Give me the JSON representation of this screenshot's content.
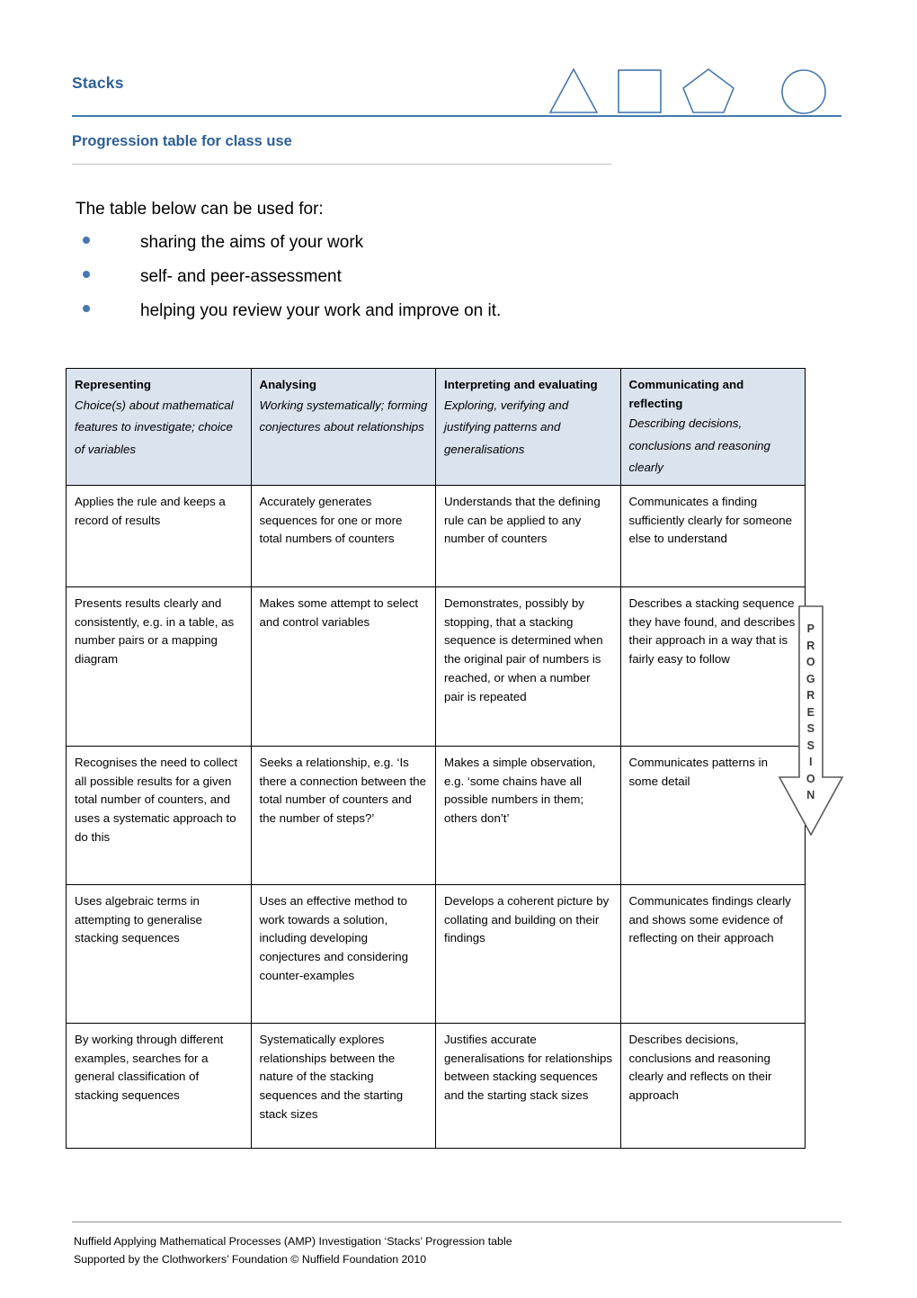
{
  "header": {
    "title": "Stacks",
    "logo_shapes": [
      "triangle",
      "square",
      "pentagon",
      "circle"
    ],
    "rule_color": "#4678ad",
    "title_color": "#2e6096"
  },
  "section": {
    "title": "Progression table for class use"
  },
  "intro": {
    "lead": "The table below can be used for:",
    "bullets": [
      "sharing the aims of your work",
      "self- and peer-assessment",
      "helping you review your work and improve on it."
    ]
  },
  "table": {
    "header_background": "#dbe3ee",
    "columns": [
      {
        "name": "Representing",
        "description": "Choice(s) about mathematical features to investigate; choice of variables"
      },
      {
        "name": "Analysing",
        "description": "Working systematically; forming conjectures about relationships"
      },
      {
        "name": "Interpreting and evaluating",
        "description": "Exploring, verifying and justifying patterns and generalisations"
      },
      {
        "name": "Communicating and reflecting",
        "description": "Describing decisions, conclusions and reasoning clearly"
      }
    ],
    "rows": [
      [
        "Applies the rule and keeps a record of results",
        "Accurately generates sequences for one or more total numbers of counters",
        "Understands that the defining rule can be applied to any number of counters",
        "Communicates a finding sufficiently clearly for someone else to understand"
      ],
      [
        "Presents results clearly and consistently, e.g. in a table, as number pairs or a mapping diagram",
        "Makes some attempt to select and control variables",
        "Demonstrates, possibly by stopping, that a stacking sequence is determined when  the original pair of numbers is reached, or when a number pair is repeated",
        "Describes a stacking sequence they have found, and describes their approach in a way that is fairly easy to follow"
      ],
      [
        "Recognises the need to collect all possible results for a given total number of counters, and uses a systematic approach to do this",
        "Seeks a relationship, e.g. ‘Is there a connection between the total number of counters and the number of steps?’",
        "Makes a simple observation, e.g. ‘some chains have all possible numbers in them; others don’t’",
        "Communicates patterns in some detail"
      ],
      [
        "Uses algebraic terms in attempting to generalise stacking sequences",
        "Uses an effective method to work towards a solution, including developing conjectures and considering counter-examples",
        "Develops a coherent picture by collating and building on their findings",
        "Communicates findings clearly and shows some evidence of reflecting on their approach"
      ],
      [
        "By working through different examples, searches for a general classification of stacking sequences",
        "Systematically explores relationships between the nature of the stacking sequences and the starting stack sizes",
        "Justifies accurate generalisations for relationships between stacking sequences and the starting stack sizes",
        "Describes decisions, conclusions and reasoning clearly and reflects on their approach"
      ]
    ]
  },
  "progression": {
    "label": "PROGRESSION",
    "letters": [
      "P",
      "R",
      "O",
      "G",
      "R",
      "E",
      "S",
      "S",
      "I",
      "O",
      "N"
    ],
    "direction": "down"
  },
  "footer": {
    "line1": "Nuffield Applying Mathematical Processes (AMP) Investigation ‘Stacks’ Progression table",
    "line2": "Supported by the Clothworkers’ Foundation © Nuffield Foundation 2010"
  }
}
